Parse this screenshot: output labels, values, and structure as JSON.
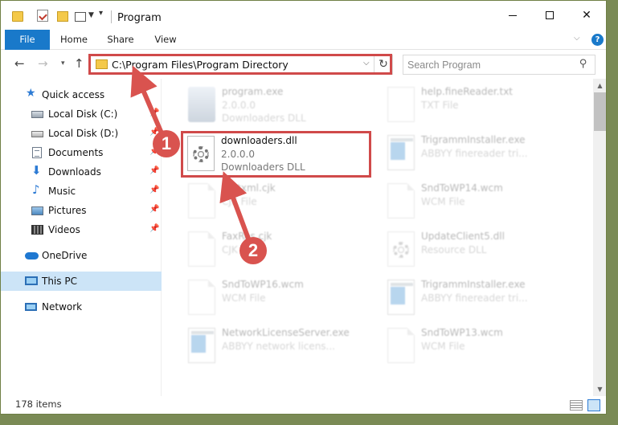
{
  "window": {
    "title": "Program",
    "minimize": "minimize",
    "maximize": "maximize",
    "close": "✕"
  },
  "ribbon": {
    "tabs": [
      "File",
      "Home",
      "Share",
      "View"
    ],
    "help": "?"
  },
  "nav": {
    "address": "C:\\Program Files\\Program Directory",
    "search_placeholder": "Search Program"
  },
  "sidebar": {
    "items": [
      {
        "label": "Quick access",
        "icon": "star-icon",
        "pinned": false
      },
      {
        "label": "Local Disk (C:)",
        "icon": "disk-icon",
        "pinned": true
      },
      {
        "label": "Local Disk (D:)",
        "icon": "disk-icon",
        "pinned": true
      },
      {
        "label": "Documents",
        "icon": "document-icon",
        "pinned": true
      },
      {
        "label": "Downloads",
        "icon": "download-icon",
        "pinned": true
      },
      {
        "label": "Music",
        "icon": "music-icon",
        "pinned": true
      },
      {
        "label": "Pictures",
        "icon": "pictures-icon",
        "pinned": true
      },
      {
        "label": "Videos",
        "icon": "videos-icon",
        "pinned": true
      },
      {
        "label": "OneDrive",
        "icon": "cloud-icon",
        "pinned": false
      },
      {
        "label": "This PC",
        "icon": "computer-icon",
        "pinned": false,
        "selected": true
      },
      {
        "label": "Network",
        "icon": "network-icon",
        "pinned": false
      }
    ]
  },
  "files": {
    "left": [
      {
        "name": "program.exe",
        "line1": "2.0.0.0",
        "line2": "Downloaders DLL",
        "icon": "exe-icon"
      },
      {
        "name": "downloaders.dll",
        "line1": "2.0.0.0",
        "line2": "Downloaders DLL",
        "icon": "dll-gear-icon"
      },
      {
        "name": "fontxml.cjk",
        "line1": "CJK File",
        "line2": "",
        "icon": "blank-file-icon"
      },
      {
        "name": "FaxRes.cjk",
        "line1": "CJK File",
        "line2": "",
        "icon": "blank-file-icon"
      },
      {
        "name": "SndToWP16.wcm",
        "line1": "WCM File",
        "line2": "",
        "icon": "blank-file-icon"
      },
      {
        "name": "NetworkLicenseServer.exe",
        "line1": "ABBYY network licens...",
        "line2": "",
        "icon": "app-icon"
      }
    ],
    "right": [
      {
        "name": "help.fineReader.txt",
        "line1": "TXT File",
        "line2": "",
        "icon": "text-file-icon"
      },
      {
        "name": "TrigrammInstaller.exe",
        "line1": "ABBYY finereader tri...",
        "line2": "",
        "icon": "app-icon"
      },
      {
        "name": "SndToWP14.wcm",
        "line1": "WCM File",
        "line2": "",
        "icon": "blank-file-icon"
      },
      {
        "name": "UpdateClient5.dll",
        "line1": "Resource DLL",
        "line2": "",
        "icon": "dll-gear-icon"
      },
      {
        "name": "TrigrammInstaller.exe",
        "line1": "ABBYY finereader tri...",
        "line2": "",
        "icon": "app-icon"
      },
      {
        "name": "SndToWP13.wcm",
        "line1": "WCM File",
        "line2": "",
        "icon": "blank-file-icon"
      }
    ]
  },
  "status": {
    "count": "178 items"
  },
  "annotations": {
    "step1": "1",
    "step2": "2",
    "color": "#d9534f"
  }
}
